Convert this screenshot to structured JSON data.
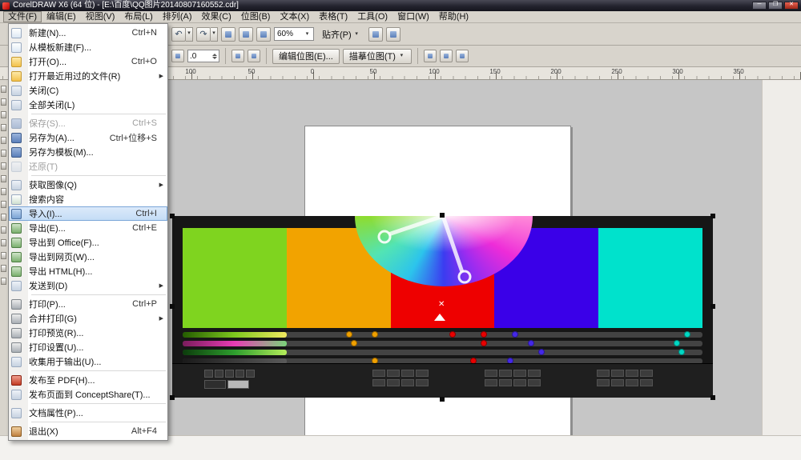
{
  "titlebar": {
    "title": "CorelDRAW X6 (64 位) - [E:\\百度\\QQ图片20140807160552.cdr]",
    "controls": [
      "minimize",
      "maximize",
      "close"
    ]
  },
  "menubar": {
    "items": [
      "文件(F)",
      "编辑(E)",
      "视图(V)",
      "布局(L)",
      "排列(A)",
      "效果(C)",
      "位图(B)",
      "文本(X)",
      "表格(T)",
      "工具(O)",
      "窗口(W)",
      "帮助(H)"
    ]
  },
  "toolbar": {
    "zoom": {
      "value": "60%"
    },
    "snap": {
      "label": "贴齐(P)"
    }
  },
  "propertybar": {
    "position_value": ".0",
    "buttons": {
      "edit_bitmap": "编辑位图(E)...",
      "trace_bitmap": "描摹位图(T)"
    }
  },
  "ruler": {
    "labels": [
      "100",
      "50",
      "0",
      "50",
      "100",
      "150",
      "200",
      "250",
      "300",
      "350"
    ]
  },
  "file_menu": {
    "items": [
      {
        "label": "新建(N)...",
        "shortcut": "Ctrl+N",
        "icon": "new"
      },
      {
        "label": "从模板新建(F)...",
        "icon": "new"
      },
      {
        "label": "打开(O)...",
        "shortcut": "Ctrl+O",
        "icon": "open"
      },
      {
        "label": "打开最近用过的文件(R)",
        "submenu": true,
        "icon": "open"
      },
      {
        "label": "关闭(C)",
        "icon": "gen"
      },
      {
        "label": "全部关闭(L)",
        "icon": "gen",
        "separator_after": true
      },
      {
        "label": "保存(S)...",
        "shortcut": "Ctrl+S",
        "disabled": true,
        "icon": "save"
      },
      {
        "label": "另存为(A)...",
        "shortcut": "Ctrl+位移+S",
        "icon": "save"
      },
      {
        "label": "另存为模板(M)...",
        "icon": "save"
      },
      {
        "label": "还原(T)",
        "disabled": true,
        "icon": "gen",
        "separator_after": true
      },
      {
        "label": "获取图像(Q)",
        "submenu": true,
        "icon": "gen"
      },
      {
        "label": "搜索内容",
        "icon": "search"
      },
      {
        "label": "导入(I)...",
        "shortcut": "Ctrl+I",
        "highlighted": true,
        "icon": "import"
      },
      {
        "label": "导出(E)...",
        "shortcut": "Ctrl+E",
        "icon": "export"
      },
      {
        "label": "导出到 Office(F)...",
        "icon": "export"
      },
      {
        "label": "导出到网页(W)...",
        "icon": "export"
      },
      {
        "label": "导出 HTML(H)...",
        "icon": "export"
      },
      {
        "label": "发送到(D)",
        "submenu": true,
        "icon": "gen",
        "separator_after": true
      },
      {
        "label": "打印(P)...",
        "shortcut": "Ctrl+P",
        "icon": "print"
      },
      {
        "label": "合并打印(G)",
        "submenu": true,
        "icon": "print"
      },
      {
        "label": "打印预览(R)...",
        "icon": "print"
      },
      {
        "label": "打印设置(U)...",
        "icon": "print"
      },
      {
        "label": "收集用于输出(U)...",
        "icon": "gen",
        "separator_after": true
      },
      {
        "label": "发布至 PDF(H)...",
        "icon": "pdf"
      },
      {
        "label": "发布页面到 ConceptShare(T)...",
        "icon": "gen",
        "separator_after": true
      },
      {
        "label": "文档属性(P)...",
        "icon": "gen",
        "separator_after": true
      },
      {
        "label": "退出(X)",
        "shortcut": "Alt+F4",
        "icon": "exit"
      }
    ]
  },
  "canvas": {
    "image": {
      "swatches": [
        "#7fd41f",
        "#f2a300",
        "#ee0000",
        "#3a00e8",
        "#00e2cc"
      ],
      "wheel_hues": [
        "#ff8ad8",
        "#ee2cd8",
        "#9a2cf0",
        "#3b3cf0",
        "#2cc4ec",
        "#52e4b4",
        "#8fdc2e"
      ],
      "slider_rows": [
        {
          "gradient": "linear-gradient(90deg,#245c00,#7ec81e,#f0e860)",
          "dots": [
            {
              "pos": 32,
              "color": "#f0a000"
            },
            {
              "pos": 37,
              "color": "#f0a000"
            },
            {
              "pos": 52,
              "color": "#e80000"
            },
            {
              "pos": 58,
              "color": "#e80000"
            },
            {
              "pos": 64,
              "color": "#4428e8"
            },
            {
              "pos": 97,
              "color": "#00d8c4"
            }
          ]
        },
        {
          "gradient": "linear-gradient(90deg,#7a1c5c,#e83cb4,#7ad47a)",
          "dots": [
            {
              "pos": 33,
              "color": "#f0a000"
            },
            {
              "pos": 58,
              "color": "#e80000"
            },
            {
              "pos": 67,
              "color": "#4428e8"
            },
            {
              "pos": 95,
              "color": "#00d8c4"
            }
          ]
        },
        {
          "gradient": "linear-gradient(90deg,#0c3c0c,#2e9e2e,#b4ec5a)",
          "dots": [
            {
              "pos": 69,
              "color": "#4428e8"
            },
            {
              "pos": 96,
              "color": "#00d8c4"
            }
          ]
        },
        {
          "gradient": "linear-gradient(90deg,#1a1a1a,#5a5a5a)",
          "dots": [
            {
              "pos": 37,
              "color": "#f0a000"
            },
            {
              "pos": 56,
              "color": "#e80000"
            },
            {
              "pos": 63,
              "color": "#4428e8"
            }
          ]
        }
      ]
    }
  }
}
